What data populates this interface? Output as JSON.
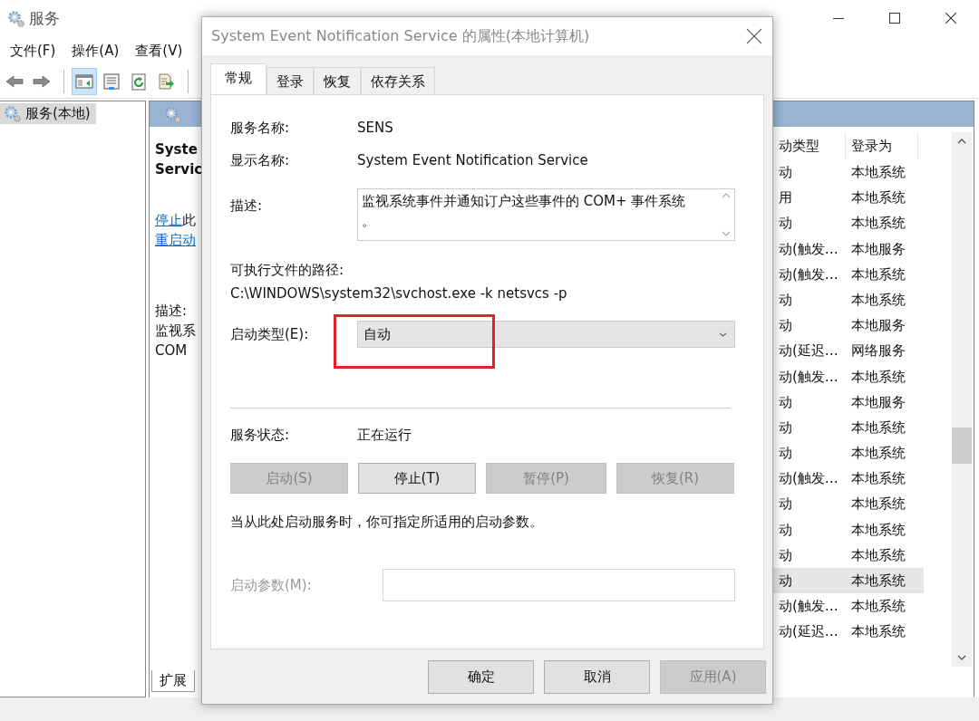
{
  "window": {
    "title": "服务",
    "menu": [
      "文件(F)",
      "操作(A)",
      "查看(V)"
    ],
    "toolbar": [
      {
        "kind": "back",
        "on": false
      },
      {
        "kind": "forward",
        "on": false
      },
      {
        "kind": "separator"
      },
      {
        "kind": "tree",
        "on": true
      },
      {
        "kind": "properties",
        "on": false
      },
      {
        "kind": "refresh",
        "on": false
      },
      {
        "kind": "export",
        "on": false
      },
      {
        "kind": "separator"
      }
    ]
  },
  "tree": {
    "items": [
      {
        "label": "服务(本地)",
        "selected": true
      }
    ]
  },
  "detail": {
    "title_lines": [
      "Syste",
      "Servic"
    ],
    "links": [
      {
        "link": "停止",
        "rest": "此"
      },
      {
        "link": "重启动"
      }
    ],
    "description_label": "描述:",
    "description_lines": [
      "监视系",
      "COM"
    ]
  },
  "services_list": {
    "columns": [
      "动类型",
      "登录为"
    ],
    "rows": [
      {
        "startup": "动",
        "logon": "本地系统",
        "selected": false
      },
      {
        "startup": "用",
        "logon": "本地系统",
        "selected": false
      },
      {
        "startup": "动",
        "logon": "本地系统",
        "selected": false
      },
      {
        "startup": "动(触发…",
        "logon": "本地服务",
        "selected": false
      },
      {
        "startup": "动(触发…",
        "logon": "本地系统",
        "selected": false
      },
      {
        "startup": "动",
        "logon": "本地系统",
        "selected": false
      },
      {
        "startup": "动",
        "logon": "本地服务",
        "selected": false
      },
      {
        "startup": "动(延迟…",
        "logon": "网络服务",
        "selected": false
      },
      {
        "startup": "动(触发…",
        "logon": "本地系统",
        "selected": false
      },
      {
        "startup": "动",
        "logon": "本地服务",
        "selected": false
      },
      {
        "startup": "动",
        "logon": "本地系统",
        "selected": false
      },
      {
        "startup": "动",
        "logon": "本地系统",
        "selected": false
      },
      {
        "startup": "动(触发…",
        "logon": "本地系统",
        "selected": false
      },
      {
        "startup": "动",
        "logon": "本地系统",
        "selected": false
      },
      {
        "startup": "动",
        "logon": "本地系统",
        "selected": false
      },
      {
        "startup": "动",
        "logon": "本地系统",
        "selected": false
      },
      {
        "startup": "动",
        "logon": "本地系统",
        "selected": true
      },
      {
        "startup": "动(触发…",
        "logon": "本地系统",
        "selected": false
      },
      {
        "startup": "动(延迟…",
        "logon": "本地系统",
        "selected": false
      }
    ]
  },
  "bottom_tabs": [
    {
      "label": "扩展",
      "selected": true
    }
  ],
  "dialog": {
    "title": "System Event Notification Service 的属性(本地计算机)",
    "tabs": [
      {
        "label": "常规",
        "selected": true
      },
      {
        "label": "登录",
        "selected": false
      },
      {
        "label": "恢复",
        "selected": false
      },
      {
        "label": "依存关系",
        "selected": false
      }
    ],
    "fields": [
      {
        "label": "服务名称:",
        "value": "SENS"
      },
      {
        "label": "显示名称:",
        "value": "System Event Notification Service"
      }
    ],
    "description": {
      "label": "描述:",
      "value_lines": [
        "监视系统事件并通知订户这些事件的 COM+ 事件系统",
        "。"
      ]
    },
    "path": {
      "label": "可执行文件的路径:",
      "value": "C:\\WINDOWS\\system32\\svchost.exe -k netsvcs -p"
    },
    "startup_type": {
      "label": "启动类型(E):",
      "value": "自动",
      "highlighted": true
    },
    "status": {
      "label": "服务状态:",
      "value": "正在运行"
    },
    "service_buttons": [
      {
        "label": "启动(S)",
        "disabled": true
      },
      {
        "label": "停止(T)",
        "disabled": false
      },
      {
        "label": "暂停(P)",
        "disabled": true
      },
      {
        "label": "恢复(R)",
        "disabled": true
      }
    ],
    "hint": "当从此处启动服务时，你可指定所适用的启动参数。",
    "start_params": {
      "label": "启动参数(M):",
      "disabled": true
    },
    "buttons": [
      {
        "label": "确定",
        "disabled": false
      },
      {
        "label": "取消",
        "disabled": false
      },
      {
        "label": "应用(A)",
        "disabled": true
      }
    ]
  }
}
